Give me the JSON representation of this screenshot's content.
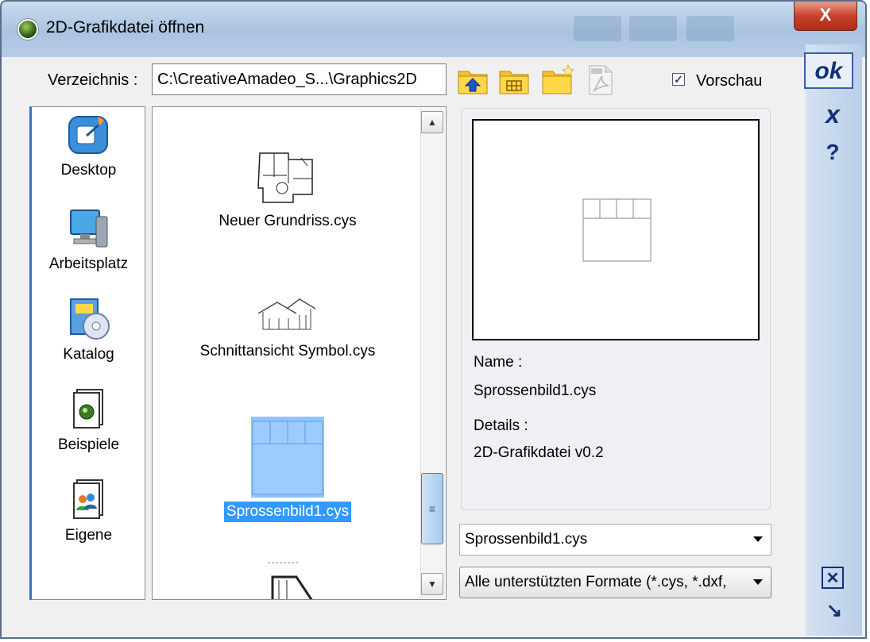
{
  "window": {
    "title": "2D-Grafikdatei öffnen",
    "close_label": "X"
  },
  "toolbar": {
    "directory_label": "Verzeichnis :",
    "directory_value": "C:\\CreativeAmadeo_S...\\Graphics2D",
    "preview_label": "Vorschau",
    "preview_checked": true,
    "tools": [
      "folder-up-icon",
      "folder-grid-icon",
      "new-folder-icon",
      "pdf-icon"
    ]
  },
  "places": [
    {
      "label": "Desktop",
      "icon": "desktop-icon"
    },
    {
      "label": "Arbeitsplatz",
      "icon": "computer-icon"
    },
    {
      "label": "Katalog",
      "icon": "catalog-icon"
    },
    {
      "label": "Beispiele",
      "icon": "examples-icon"
    },
    {
      "label": "Eigene",
      "icon": "user-files-icon"
    }
  ],
  "files": [
    {
      "name": "Neuer Grundriss.cys",
      "selected": false
    },
    {
      "name": "Schnittansicht Symbol.cys",
      "selected": false
    },
    {
      "name": "Sprossenbild1.cys",
      "selected": true
    }
  ],
  "info": {
    "name_label": "Name :",
    "name_value": "Sprossenbild1.cys",
    "details_label": "Details :",
    "details_value": "2D-Grafikdatei v0.2"
  },
  "filename_combo": "Sprossenbild1.cys",
  "format_combo": "Alle unterstützten Formate (*.cys, *.dxf,",
  "side_buttons": {
    "ok": "ok",
    "cancel": "x",
    "help": "?",
    "close": "☒",
    "resize": "↘"
  },
  "colors": {
    "selection": "#3399ff",
    "accent": "#10307c"
  }
}
